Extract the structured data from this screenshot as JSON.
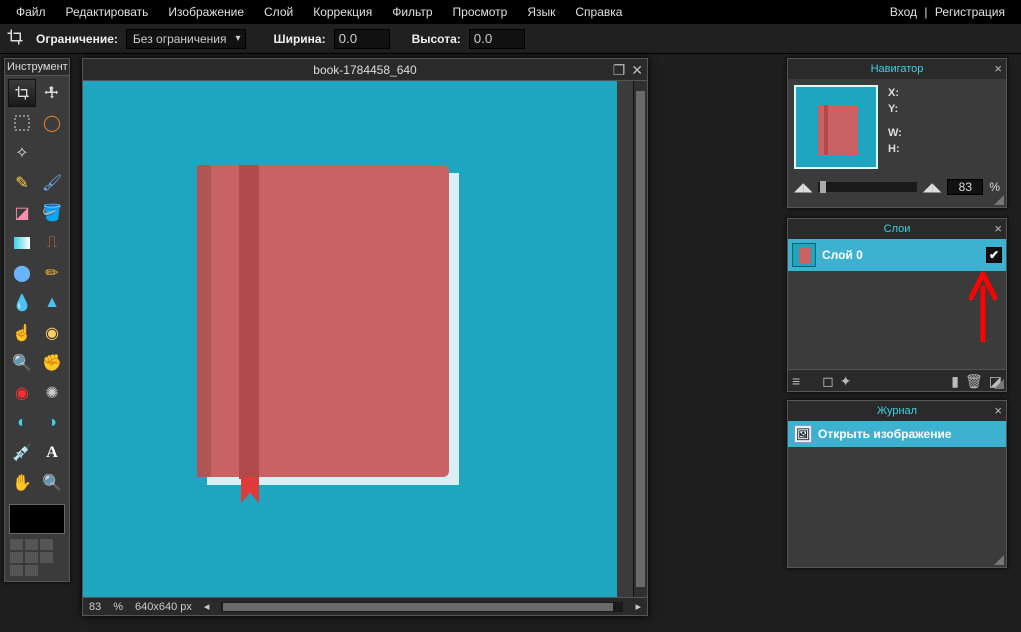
{
  "menu": {
    "file": "Файл",
    "edit": "Редактировать",
    "image": "Изображение",
    "layer": "Слой",
    "adjust": "Коррекция",
    "filter": "Фильтр",
    "view": "Просмотр",
    "lang": "Язык",
    "help": "Справка"
  },
  "auth": {
    "login": "Вход",
    "sep": "|",
    "register": "Регистрация"
  },
  "options": {
    "constraint_label": "Ограничение:",
    "constraint_value": "Без ограничения",
    "width_label": "Ширина:",
    "width_value": "0.0",
    "height_label": "Высота:",
    "height_value": "0.0"
  },
  "tool_panel": {
    "title": "Инструмент"
  },
  "document": {
    "title": "book-1784458_640",
    "zoom_value": "83",
    "zoom_unit": "%",
    "dimensions": "640x640 px"
  },
  "navigator": {
    "title": "Навигатор",
    "x_label": "X:",
    "y_label": "Y:",
    "w_label": "W:",
    "h_label": "H:",
    "zoom_value": "83",
    "zoom_unit": "%"
  },
  "layers": {
    "title": "Слои",
    "layer0": "Слой 0"
  },
  "history": {
    "title": "Журнал",
    "open": "Открыть изображение"
  }
}
